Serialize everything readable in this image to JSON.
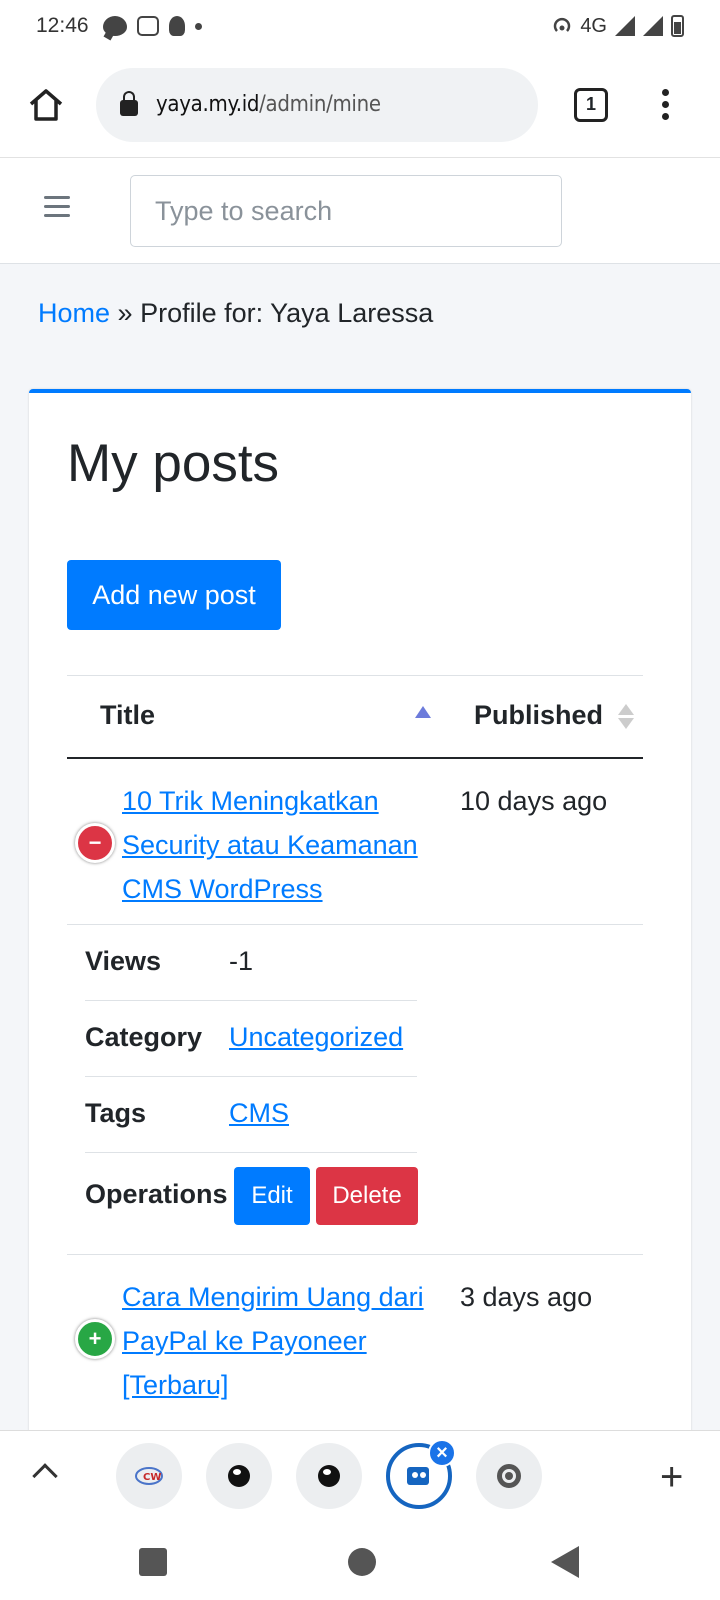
{
  "status_bar": {
    "time": "12:46",
    "network": "4G"
  },
  "browser": {
    "url_domain": "yaya.my.id",
    "url_path": "/admin/mine",
    "tab_count": "1"
  },
  "header": {
    "search_placeholder": "Type to search"
  },
  "breadcrumb": {
    "home": "Home",
    "separator": "»",
    "current": "Profile for: Yaya Laressa"
  },
  "card": {
    "title": "My posts",
    "add_button": "Add new post",
    "columns": {
      "title": "Title",
      "published": "Published"
    },
    "posts": [
      {
        "title": "10 Trik Meningkatkan Security atau Keamanan CMS WordPress",
        "published": "10 days ago",
        "toggle": "−",
        "details": {
          "views_label": "Views",
          "views": "-1",
          "category_label": "Category",
          "category": "Uncategorized",
          "tags_label": "Tags",
          "tags": "CMS",
          "operations_label": "Operations",
          "edit": "Edit",
          "delete": "Delete"
        }
      },
      {
        "title": "Cara Mengirim Uang dari PayPal ke Payoneer [Terbaru]",
        "published": "3 days ago",
        "toggle": "+"
      }
    ]
  },
  "tab_strip": {
    "close_glyph": "×",
    "add_glyph": "+"
  },
  "colors": {
    "primary": "#007bff",
    "danger": "#dc3545",
    "success": "#28a745",
    "content_bg": "#f4f6f9"
  }
}
